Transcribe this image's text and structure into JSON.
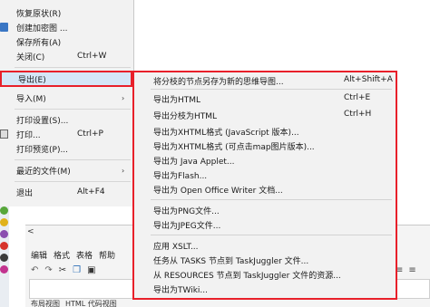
{
  "file_menu": {
    "items": [
      {
        "label": "恢复原状(R)",
        "shortcut": ""
      },
      {
        "label": "创建加密图 ...",
        "shortcut": ""
      },
      {
        "label": "保存所有(A)",
        "shortcut": ""
      },
      {
        "label": "关闭(C)",
        "shortcut": "Ctrl+W"
      },
      {
        "label": "导出(E)",
        "shortcut": ""
      },
      {
        "label": "导入(M)",
        "shortcut": ""
      },
      {
        "label": "打印设置(S)...",
        "shortcut": ""
      },
      {
        "label": "打印...",
        "shortcut": "Ctrl+P"
      },
      {
        "label": "打印预览(P)...",
        "shortcut": ""
      },
      {
        "label": "最近的文件(M)",
        "shortcut": ""
      },
      {
        "label": "退出",
        "shortcut": "Alt+F4"
      }
    ],
    "submenu_arrow": "›"
  },
  "export_submenu": {
    "items": [
      {
        "label": "将分枝的节点另存为新的思维导图...",
        "shortcut": "Alt+Shift+A"
      },
      {
        "label": "导出为HTML",
        "shortcut": "Ctrl+E"
      },
      {
        "label": "导出分枝为HTML",
        "shortcut": "Ctrl+H"
      },
      {
        "label": "导出为XHTML格式 (JavaScript 版本)...",
        "shortcut": ""
      },
      {
        "label": "导出为XHTML格式 (可点击map图片版本)...",
        "shortcut": ""
      },
      {
        "label": "导出为 Java Applet...",
        "shortcut": ""
      },
      {
        "label": "导出为Flash...",
        "shortcut": ""
      },
      {
        "label": "导出为 Open Office Writer 文档...",
        "shortcut": ""
      },
      {
        "label": "导出为PNG文件...",
        "shortcut": ""
      },
      {
        "label": "导出为JPEG文件...",
        "shortcut": ""
      },
      {
        "label": "应用 XSLT...",
        "shortcut": ""
      },
      {
        "label": "任务从 TASKS 节点到 TaskJuggler 文件...",
        "shortcut": ""
      },
      {
        "label": "从 RESOURCES 节点到 TaskJuggler 文件的资源...",
        "shortcut": ""
      },
      {
        "label": "导出为TWiki...",
        "shortcut": ""
      }
    ]
  },
  "editor_pane": {
    "collapse_arrow": "<",
    "menubar": [
      "编辑",
      "格式",
      "表格",
      "帮助"
    ],
    "tabs": [
      "布局视图",
      "HTML 代码视图"
    ]
  },
  "icons": {
    "collapse": "chevron-left-icon",
    "undo": "undo-icon",
    "redo": "redo-icon",
    "cut": "cut-icon",
    "copy": "copy-icon",
    "paste": "paste-icon",
    "align": "align-icon"
  },
  "colors": {
    "highlight_border": "#e8202a",
    "menu_background": "#f2f2f2",
    "selected_background": "#d5e6f7"
  }
}
